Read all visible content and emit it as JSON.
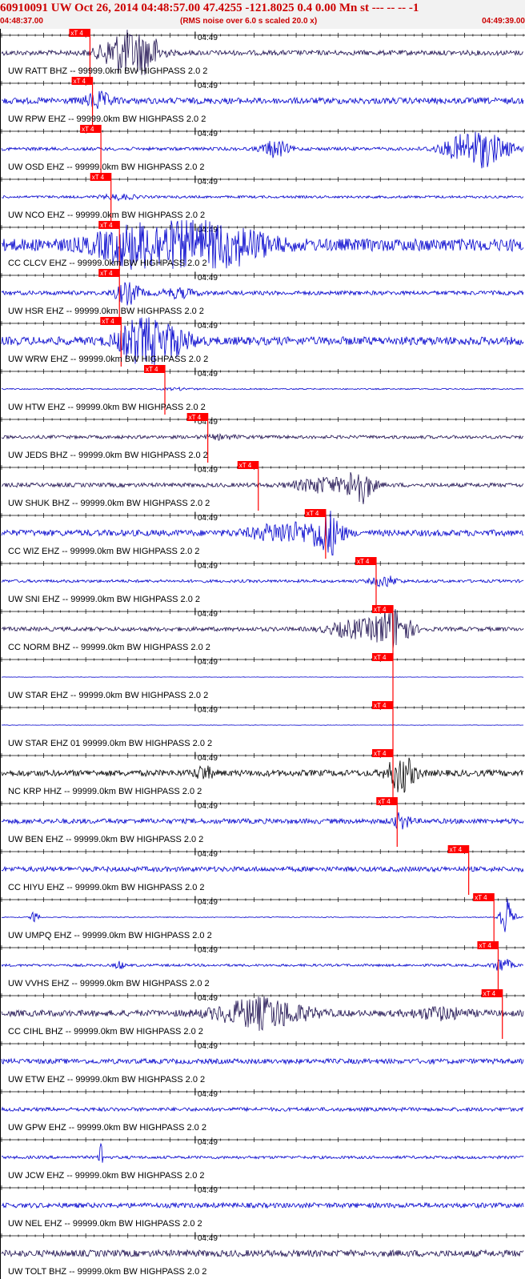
{
  "header": {
    "title": "60910091 UW Oct 26, 2014 04:48:57.00   47.4255 -121.8025  0.4 0.00 Mn st --- -- --  -1",
    "start_time": "04:48:37.00",
    "note": "(RMS noise over 6.0 s scaled 20.0 x)",
    "end_time": "04:49:39.00"
  },
  "chart_data": {
    "type": "line",
    "x_start_label": "04:48:37.00",
    "x_end_label": "04:49:39.00",
    "time_span_s": 62,
    "major_tick_label": "04:49",
    "major_tick_s": 23,
    "pick_label": "xT 4",
    "grid": true,
    "series": [
      {
        "label": "UW RATT BHZ -- 99999.0km BW  HIGHPASS  2.0  2",
        "color": "#1e1050",
        "pick_s": 10.5,
        "bursts": [
          {
            "t": 14.5,
            "a": 1.0,
            "w": 2.5
          },
          {
            "t": 17.5,
            "a": 0.7,
            "w": 1.5
          }
        ],
        "noise": 0.12
      },
      {
        "label": "UW RPW EHZ -- 99999.0km BW  HIGHPASS  2.0  2",
        "color": "#0000cc",
        "pick_s": 10.8,
        "bursts": [
          {
            "t": 11.5,
            "a": 0.35,
            "w": 1.5
          }
        ],
        "noise": 0.15
      },
      {
        "label": "UW OSD EHZ -- 99999.0km BW  HIGHPASS  2.0  2",
        "color": "#0000cc",
        "pick_s": 11.8,
        "bursts": [
          {
            "t": 32.5,
            "a": 0.4,
            "w": 1.5
          },
          {
            "t": 56.5,
            "a": 0.9,
            "w": 3.5
          }
        ],
        "noise": 0.08
      },
      {
        "label": "UW NCO EHZ -- 99999.0km BW  HIGHPASS  2.0  2",
        "color": "#0000cc",
        "pick_s": 13.0,
        "bursts": [
          {
            "t": 14.0,
            "a": 0.12,
            "w": 2.0
          }
        ],
        "noise": 0.06
      },
      {
        "label": "CC CLCV EHZ -- 99999.0km BW  HIGHPASS  2.0  2",
        "color": "#0000cc",
        "pick_s": 14.0,
        "bursts": [
          {
            "t": 15.0,
            "a": 0.7,
            "w": 4.0
          },
          {
            "t": 21.5,
            "a": 0.9,
            "w": 5.0
          },
          {
            "t": 28.0,
            "a": 0.6,
            "w": 4.0
          }
        ],
        "noise": 0.3
      },
      {
        "label": "UW HSR EHZ -- 99999.0km BW  HIGHPASS  2.0  2",
        "color": "#0000cc",
        "pick_s": 14.0,
        "bursts": [
          {
            "t": 15.0,
            "a": 0.5,
            "w": 1.5
          },
          {
            "t": 21.0,
            "a": 0.2,
            "w": 2.0
          }
        ],
        "noise": 0.1
      },
      {
        "label": "UW WRW EHZ -- 99999.0km BW  HIGHPASS  2.0  2",
        "color": "#0000cc",
        "pick_s": 14.2,
        "bursts": [
          {
            "t": 16.5,
            "a": 1.0,
            "w": 2.5
          },
          {
            "t": 20.0,
            "a": 0.6,
            "w": 2.5
          }
        ],
        "noise": 0.2
      },
      {
        "label": "UW HTW EHZ -- 99999.0km BW  HIGHPASS  2.0  2",
        "color": "#0000cc",
        "pick_s": 19.4,
        "bursts": [
          {
            "t": 21.0,
            "a": 0.05,
            "w": 2.0
          }
        ],
        "noise": 0.03
      },
      {
        "label": "UW JEDS BHZ -- 99999.0km BW  HIGHPASS  2.0  2",
        "color": "#1e1050",
        "pick_s": 24.5,
        "bursts": [
          {
            "t": 26.0,
            "a": 0.08,
            "w": 2.0
          }
        ],
        "noise": 0.08
      },
      {
        "label": "UW SHUK BHZ -- 99999.0km BW  HIGHPASS  2.0  2",
        "color": "#1e1050",
        "pick_s": 30.5,
        "bursts": [
          {
            "t": 42.5,
            "a": 0.9,
            "w": 1.5
          },
          {
            "t": 38.0,
            "a": 0.35,
            "w": 3.0
          }
        ],
        "noise": 0.1
      },
      {
        "label": "CC WIZ EHZ -- 99999.0km BW  HIGHPASS  2.0  2",
        "color": "#0000cc",
        "pick_s": 38.5,
        "bursts": [
          {
            "t": 38.8,
            "a": 1.0,
            "w": 1.5
          },
          {
            "t": 34.0,
            "a": 0.45,
            "w": 4.0
          }
        ],
        "noise": 0.15
      },
      {
        "label": "UW SNI EHZ -- 99999.0km BW  HIGHPASS  2.0  2",
        "color": "#0000cc",
        "pick_s": 44.5,
        "bursts": [
          {
            "t": 45.5,
            "a": 0.25,
            "w": 1.5
          }
        ],
        "noise": 0.07
      },
      {
        "label": "CC NORM BHZ -- 99999.0km BW  HIGHPASS  2.0  2",
        "color": "#1e1050",
        "pick_s": 46.5,
        "bursts": [
          {
            "t": 46.5,
            "a": 1.0,
            "w": 2.0
          },
          {
            "t": 42.0,
            "a": 0.4,
            "w": 3.0
          }
        ],
        "noise": 0.1
      },
      {
        "label": "UW STAR EHZ -- 99999.0km BW  HIGHPASS  2.0  2",
        "color": "#0000cc",
        "pick_s": 46.5,
        "bursts": [],
        "noise": 0.01
      },
      {
        "label": "UW STAR EHZ 01 99999.0km BW  HIGHPASS  2.0  2",
        "color": "#0000cc",
        "pick_s": 46.5,
        "bursts": [],
        "noise": 0.01
      },
      {
        "label": "NC KRP HHZ -- 99999.0km BW  HIGHPASS  2.0  2",
        "color": "#000000",
        "pick_s": 46.5,
        "bursts": [
          {
            "t": 47.5,
            "a": 0.9,
            "w": 1.5
          },
          {
            "t": 24.0,
            "a": 0.3,
            "w": 1.0
          }
        ],
        "noise": 0.15
      },
      {
        "label": "UW BEN EHZ -- 99999.0km BW  HIGHPASS  2.0  2",
        "color": "#0000cc",
        "pick_s": 47.0,
        "bursts": [
          {
            "t": 47.5,
            "a": 0.35,
            "w": 1.0
          }
        ],
        "noise": 0.12
      },
      {
        "label": "CC HIYU EHZ -- 99999.0km BW  HIGHPASS  2.0  2",
        "color": "#0000cc",
        "pick_s": 55.5,
        "bursts": [],
        "noise": 0.12
      },
      {
        "label": "UW UMPQ EHZ -- 99999.0km BW  HIGHPASS  2.0  2",
        "color": "#0000cc",
        "pick_s": 58.5,
        "bursts": [
          {
            "t": 60.0,
            "a": 1.0,
            "w": 0.8
          },
          {
            "t": 4.0,
            "a": 0.6,
            "w": 0.4
          }
        ],
        "noise": 0.02
      },
      {
        "label": "UW VVHS EHZ -- 99999.0km BW  HIGHPASS  2.0  2",
        "color": "#0000cc",
        "pick_s": 59.0,
        "bursts": [
          {
            "t": 59.5,
            "a": 0.35,
            "w": 1.0
          },
          {
            "t": 14.0,
            "a": 0.2,
            "w": 0.5
          }
        ],
        "noise": 0.06
      },
      {
        "label": "CC CIHL BHZ -- 99999.0km BW  HIGHPASS  2.0  2",
        "color": "#1e1050",
        "pick_s": 59.5,
        "bursts": [
          {
            "t": 31.0,
            "a": 0.7,
            "w": 5.0
          },
          {
            "t": 52.0,
            "a": 0.25,
            "w": 3.0
          }
        ],
        "noise": 0.15
      },
      {
        "label": "UW ETW EHZ -- 99999.0km BW  HIGHPASS  2.0  2",
        "color": "#0000cc",
        "pick_s": null,
        "bursts": [],
        "noise": 0.12
      },
      {
        "label": "UW GPW EHZ -- 99999.0km BW  HIGHPASS  2.0  2",
        "color": "#0000cc",
        "pick_s": null,
        "bursts": [],
        "noise": 0.09
      },
      {
        "label": "UW JCW EHZ -- 99999.0km BW  HIGHPASS  2.0  2",
        "color": "#0000cc",
        "pick_s": null,
        "bursts": [
          {
            "t": 11.8,
            "a": 1.0,
            "w": 0.2
          }
        ],
        "noise": 0.07
      },
      {
        "label": "UW NEL EHZ -- 99999.0km BW  HIGHPASS  2.0  2",
        "color": "#0000cc",
        "pick_s": null,
        "bursts": [],
        "noise": 0.12
      },
      {
        "label": "UW TOLT BHZ -- 99999.0km BW  HIGHPASS  2.0  2",
        "color": "#1e1050",
        "pick_s": null,
        "bursts": [],
        "noise": 0.16
      }
    ]
  }
}
